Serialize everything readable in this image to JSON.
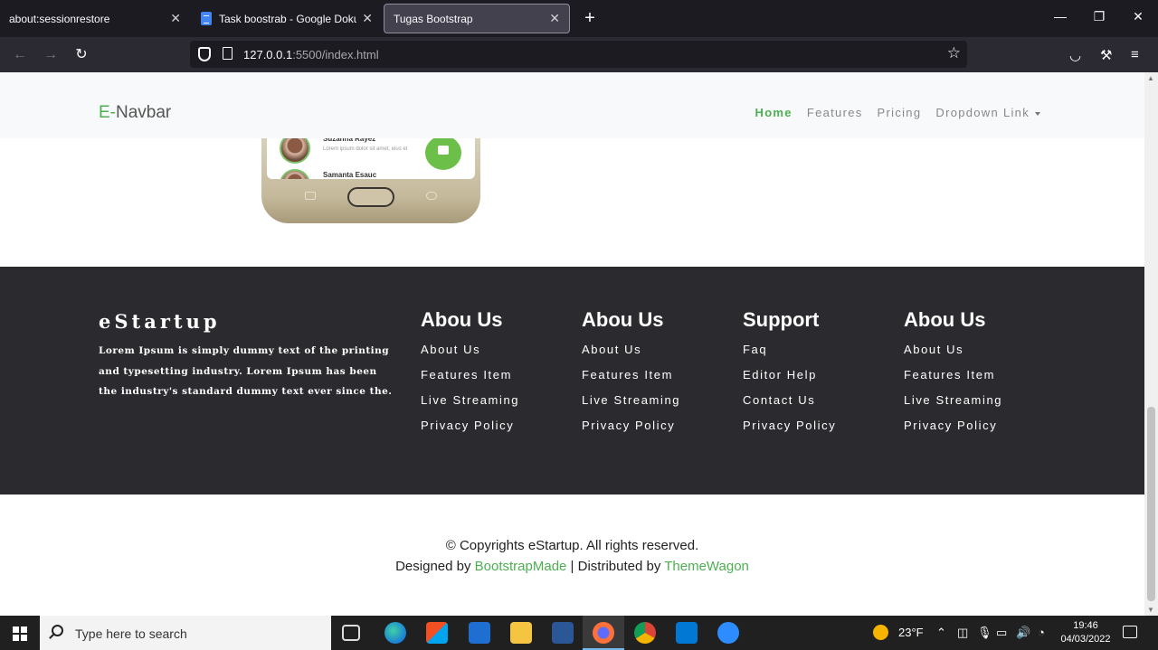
{
  "browser": {
    "tabs": [
      {
        "title": "about:sessionrestore"
      },
      {
        "title": "Task boostrab - Google Dokumen"
      },
      {
        "title": "Tugas Bootstrap"
      }
    ],
    "url_host": "127.0.0.1",
    "url_path": ":5500/index.html"
  },
  "site_nav": {
    "brand_prefix": "E-",
    "brand_rest": "Navbar",
    "links": [
      "Home",
      "Features",
      "Pricing",
      "Dropdown Link"
    ]
  },
  "phone": {
    "contacts": [
      {
        "name": "Suzanna Rayez",
        "message": "Lorem ipsum dolor sit amet, eius et"
      },
      {
        "name": "Samanta Esauc",
        "message": ""
      }
    ]
  },
  "footer": {
    "brand": "eStartup",
    "about_text": "Lorem Ipsum is simply dummy text of the printing and typesetting industry. Lorem Ipsum has been the industry's standard dummy text ever since the.",
    "columns": [
      {
        "title": "Abou Us",
        "links": [
          "About Us",
          "Features Item",
          "Live Streaming",
          "Privacy Policy"
        ]
      },
      {
        "title": "Abou Us",
        "links": [
          "About Us",
          "Features Item",
          "Live Streaming",
          "Privacy Policy"
        ]
      },
      {
        "title": "Support",
        "links": [
          "Faq",
          "Editor Help",
          "Contact Us",
          "Privacy Policy"
        ]
      },
      {
        "title": "Abou Us",
        "links": [
          "About Us",
          "Features Item",
          "Live Streaming",
          "Privacy Policy"
        ]
      }
    ]
  },
  "copyright": {
    "line1": "© Copyrights eStartup. All rights reserved.",
    "designed_by": "Designed by ",
    "bootstrapmade": "BootstrapMade",
    "distributed_by": " | Distributed by ",
    "themewagon": "ThemeWagon"
  },
  "taskbar": {
    "search_placeholder": "Type here to search",
    "weather": "23°F",
    "time": "19:46",
    "date": "04/03/2022"
  },
  "colors": {
    "accent_green": "#4caf50",
    "footer_bg": "#2b2b2f",
    "chrome_dark": "#1c1b22"
  }
}
